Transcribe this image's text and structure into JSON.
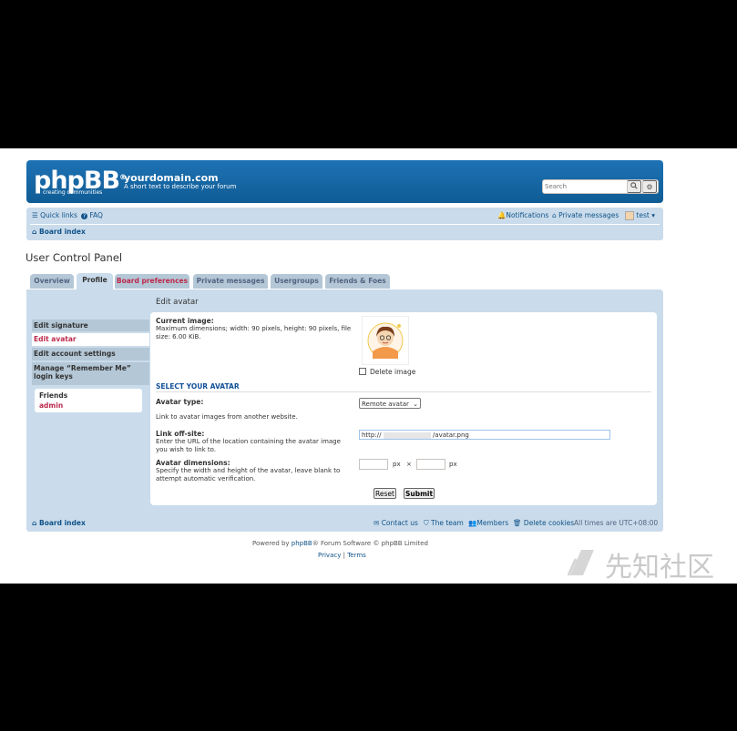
{
  "header": {
    "logo_text": "phpBB",
    "logo_reg": "®",
    "logo_sub": "creating communities",
    "site_name": "yourdomain.com",
    "site_desc": "A short text to describe your forum",
    "search_placeholder": "Search"
  },
  "navbar": {
    "quick_links": "Quick links",
    "faq": "FAQ",
    "notifications": "Notifications",
    "private_messages": "Private messages",
    "username": "test",
    "board_index": "Board index"
  },
  "page_title": "User Control Panel",
  "tabs": [
    {
      "label": "Overview"
    },
    {
      "label": "Profile"
    },
    {
      "label": "Board preferences"
    },
    {
      "label": "Private messages"
    },
    {
      "label": "Usergroups"
    },
    {
      "label": "Friends & Foes"
    }
  ],
  "sidemenu": {
    "items": [
      {
        "label": "Edit signature"
      },
      {
        "label": "Edit avatar"
      },
      {
        "label": "Edit account settings"
      },
      {
        "label": "Manage “Remember Me” login keys"
      }
    ],
    "friends_title": "Friends",
    "friends_user": "admin"
  },
  "form": {
    "heading": "Edit avatar",
    "current_image_label": "Current image:",
    "current_image_desc": "Maximum dimensions; width: 90 pixels, height: 90 pixels, file size: 6.00 KiB.",
    "delete_image_label": "Delete image",
    "select_avatar_heading": "SELECT YOUR AVATAR",
    "avatar_type_label": "Avatar type:",
    "avatar_type_value": "Remote avatar",
    "remote_desc": "Link to avatar images from another website.",
    "link_offsite_label": "Link off-site:",
    "link_offsite_desc": "Enter the URL of the location containing the avatar image you wish to link to.",
    "url_prefix": "http://",
    "url_suffix": "/avatar.png",
    "dimensions_label": "Avatar dimensions:",
    "dimensions_desc": "Specify the width and height of the avatar, leave blank to attempt automatic verification.",
    "px1": "px",
    "times": "×",
    "px2": "px",
    "reset_label": "Reset",
    "submit_label": "Submit"
  },
  "footer": {
    "board_index": "Board index",
    "contact_us": "Contact us",
    "the_team": "The team",
    "members": "Members",
    "delete_cookies": "Delete cookies",
    "timezone": "All times are UTC+08:00",
    "powered_prefix": "Powered by ",
    "powered_link": "phpBB",
    "powered_suffix": "® Forum Software © phpBB Limited",
    "privacy": "Privacy",
    "separator": "|",
    "terms": "Terms"
  },
  "watermark": {
    "text": "先知社区"
  },
  "colors": {
    "header_blue": "#1b6ba9",
    "nav_bg": "#cadceb",
    "tab_bg": "#b4c7d6",
    "link": "#105289",
    "active_red": "#bc2a4d"
  }
}
